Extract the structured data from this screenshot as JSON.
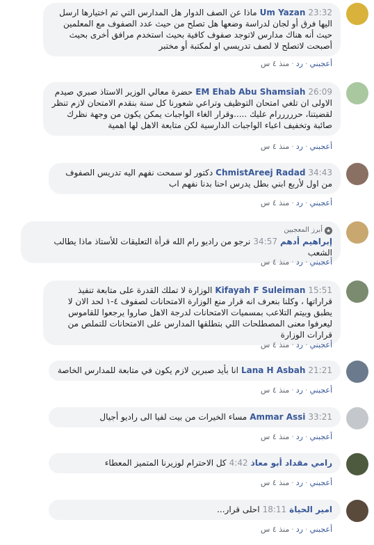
{
  "labels": {
    "like": "أعجبني",
    "reply": "رد",
    "dot": "·"
  },
  "comments": [
    {
      "author": "Um Yazan",
      "time": "23:32",
      "text": "ماذا عن الصف الدوار هل المدارس التي تم اختيارها ارسل اليها فرق أو لجان لدراسة وضعها هل تصلح من حيث عدد الصفوف مع المعلمين حيث أنه هناك مدارس لاتوجد صفوف كافية بحيث استخدم مرافق أخرى بحيث أصبحت لاتصلح لا لصف تدريسي او لمكتبة أو مختبر",
      "age": "منذ ٤ س",
      "avatar_color": "#d8b23a"
    },
    {
      "author": "EM Ehab Abu Shamsiah",
      "time": "26:09",
      "text": "حضرة معالي الوزير الاستاذ صبري صيدم الاولى ان تلغي امتحان التوظيف وتراعي شعورنا كل سنة بنقدم الامتحان لازم تنظر لقضيتنا، حرررررام عليك .....وقرار الغاء الواجبات يمكن يكون من وجهة نظرك صائبة وتخفيف اعباء الواجبات الدارسية لكن متابعة الاهل لها اهمية",
      "age": "منذ ٤ س",
      "avatar_color": "#a9c8a0"
    },
    {
      "author": "ChmistAreej Radad",
      "time": "34:43",
      "text": "دكتور لو سمحت نفهم اليه تدريس الصفوف من اول لأربع ابني بطل يدرس احنا بدنا نفهم اب",
      "age": "منذ ٤ س",
      "avatar_color": "#8a6f63"
    },
    {
      "badge": "أبرز المعجبين",
      "author": "إبراهيم أدهم",
      "time": "34:57",
      "text": "نرجو من راديو رام الله قرأة التعليقات للأستاذ ماذا يطالب الشعب",
      "age": "منذ ٤ س",
      "avatar_color": "#c9a870"
    },
    {
      "author": "Kifayah F Suleiman",
      "time": "15:51",
      "text": "الوزارة لا تملك القدرة على متابعة تنفيذ قراراتها ، وكلنا بنعرف انه قرار منع الوزارة الامتحانات لصفوف ٤-١ لحد الان لا يطبق وبيتم التلاعب بمسميات الامتحانات لدرجة الاهل صاروا يرجعوا للقاموس ليعرفوا معنى المصطلحات اللي بتطلقها المدارس على الامتحانات للتملص من قرارات الوزارة",
      "age": "منذ ٤ س",
      "avatar_color": "#7a8b6f"
    },
    {
      "author": "Lana H Asbah",
      "time": "21:21",
      "text": "انا بأيد صبرين لازم يكون في متابعة للمدارس الخاصة",
      "age": "منذ ٤ س",
      "avatar_color": "#6b7a8c"
    },
    {
      "author": "Ammar Assi",
      "time": "33:21",
      "text": "مساء الخيرات من بيت لفيا الى راديو أجيال",
      "age": "منذ ٤ س",
      "avatar_color": "#c4c7cc"
    },
    {
      "author": "رامي مقداد أبو معاذ",
      "time": "4:42",
      "text": "كل الاحترام لوزيرنا المتميز المعطاء",
      "age": "منذ ٤ س",
      "avatar_color": "#4d5a3e"
    },
    {
      "author": "امير الحياة",
      "time": "18:11",
      "text": "احلى قرار...",
      "age": "منذ ٤ س",
      "avatar_color": "#5a4a3c"
    }
  ]
}
